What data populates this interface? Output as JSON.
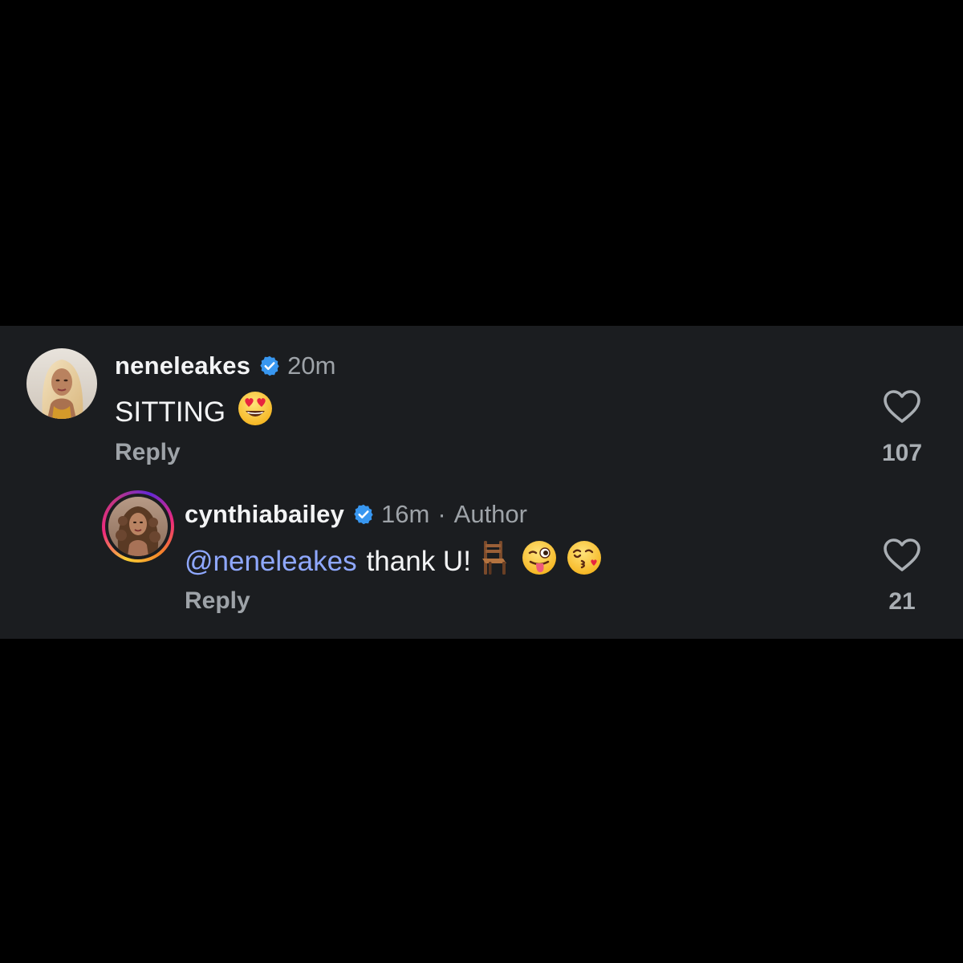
{
  "comments": [
    {
      "username": "neneleakes",
      "time": "20m",
      "text": "SITTING",
      "emojis": [
        "heart-eyes-emoji"
      ],
      "reply_label": "Reply",
      "likes": "107"
    }
  ],
  "reply": {
    "username": "cynthiabailey",
    "time": "16m",
    "separator": "·",
    "badge": "Author",
    "mention": "@neneleakes",
    "text": "thank U!",
    "emojis": [
      "chair-emoji",
      "winking-tongue-emoji",
      "kissing-heart-emoji"
    ],
    "reply_label": "Reply",
    "likes": "21"
  },
  "colors": {
    "panel_bg": "#1b1d20",
    "mention": "#8fa8ff",
    "verified": "#3897f0",
    "muted_text": "#9ea3a8"
  }
}
